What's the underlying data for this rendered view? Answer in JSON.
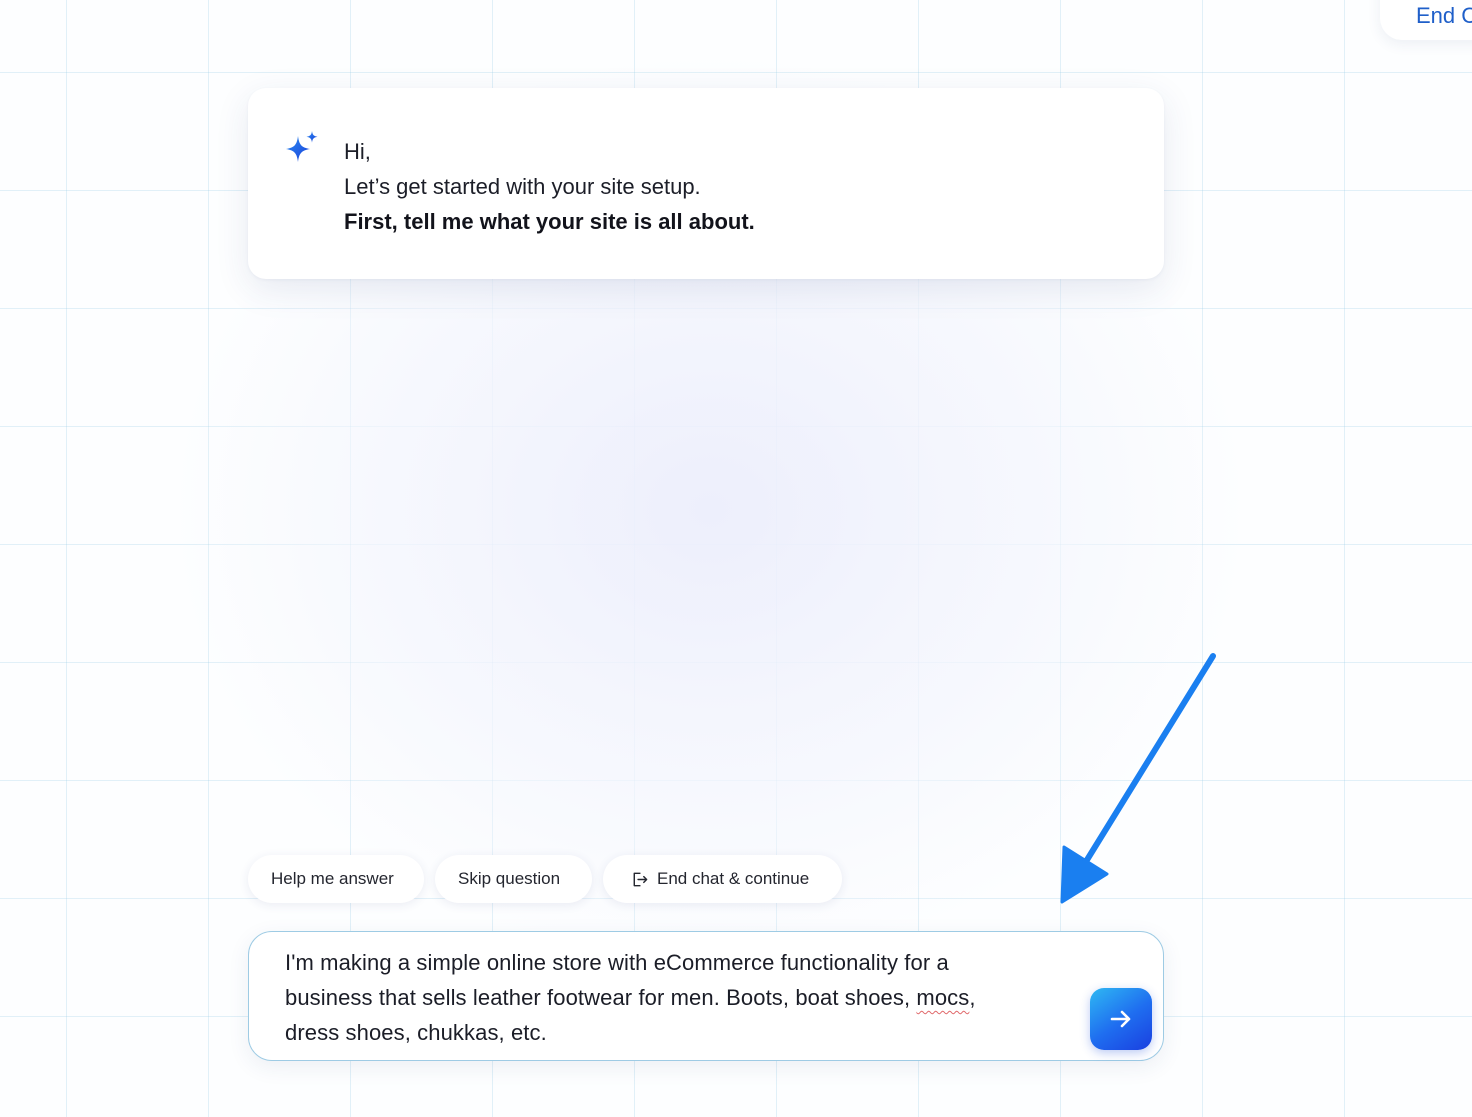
{
  "colors": {
    "accent": "#1f6ef0",
    "link": "#1f5fc9",
    "grid": "#96cde6",
    "annotation_arrow": "#1a7ff0",
    "input_border": "#9ecbe4"
  },
  "header": {
    "top_right_button_label": "End C"
  },
  "bot_message": {
    "icon": "sparkle-icon",
    "greeting": "Hi,",
    "line": "Let’s get started with your site setup.",
    "question": "First, tell me what your site is all about."
  },
  "actions": [
    {
      "label": "Help me answer"
    },
    {
      "label": "Skip question"
    },
    {
      "label": "End chat & continue",
      "icon": "exit-icon"
    }
  ],
  "input": {
    "value_lines": [
      "I'm making a simple online store with eCommerce functionality for a",
      "business that sells leather footwear for men. Boots, boat shoes, ",
      "dress shoes, chukkas, etc."
    ],
    "misspelled_word": "mocs",
    "after_misspelled": ",",
    "send_icon": "arrow-right-icon"
  },
  "annotation": {
    "icon": "pointer-arrow-icon"
  }
}
